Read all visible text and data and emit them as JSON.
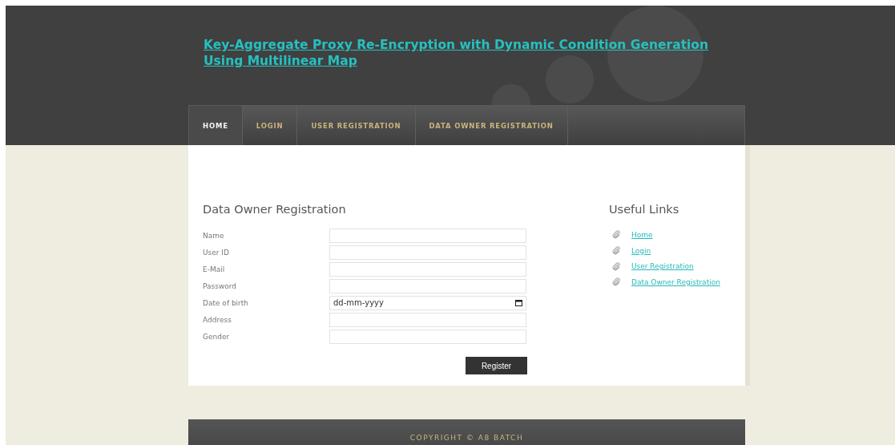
{
  "header": {
    "title": "Key-Aggregate Proxy Re-Encryption with Dynamic Condition Generation Using Multilinear Map"
  },
  "nav": [
    {
      "label": "HOME",
      "selected": true
    },
    {
      "label": "LOGIN",
      "selected": false
    },
    {
      "label": "USER REGISTRATION",
      "selected": false
    },
    {
      "label": "DATA OWNER REGISTRATION",
      "selected": false
    }
  ],
  "form": {
    "heading": "Data Owner Registration",
    "fields": [
      {
        "label": "Name",
        "kind": "text"
      },
      {
        "label": "User ID",
        "kind": "text"
      },
      {
        "label": "E-Mail",
        "kind": "text"
      },
      {
        "label": "Password",
        "kind": "text"
      },
      {
        "label": "Date of birth",
        "kind": "date",
        "placeholder": "dd-mm-yyyy"
      },
      {
        "label": "Address",
        "kind": "text"
      },
      {
        "label": "Gender",
        "kind": "text"
      }
    ],
    "button": "Register"
  },
  "sidebar": {
    "heading": "Useful Links",
    "links": [
      "Home",
      "Login",
      "User Registration",
      "Data Owner Registration"
    ]
  },
  "footer": "COPYRIGHT © A8 BATCH"
}
